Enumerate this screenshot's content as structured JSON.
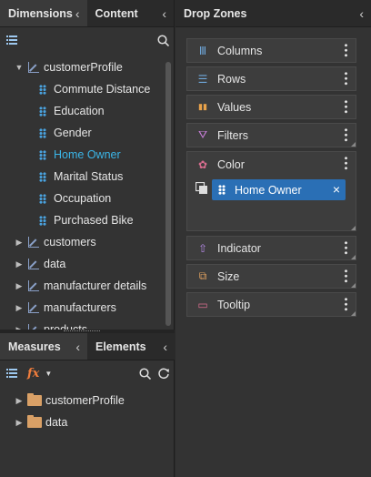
{
  "left_top": {
    "tabs": [
      {
        "label": "Dimensions",
        "chevron": "‹"
      },
      {
        "label": "Content",
        "chevron": "‹"
      }
    ],
    "tree": [
      {
        "label": "customerProfile",
        "expanded": true,
        "children": [
          {
            "label": "Commute Distance"
          },
          {
            "label": "Education"
          },
          {
            "label": "Gender"
          },
          {
            "label": "Home Owner",
            "highlighted": true
          },
          {
            "label": "Marital Status"
          },
          {
            "label": "Occupation"
          },
          {
            "label": "Purchased Bike"
          }
        ]
      },
      {
        "label": "customers"
      },
      {
        "label": "data"
      },
      {
        "label": "manufacturer details"
      },
      {
        "label": "manufacturers"
      },
      {
        "label": "products"
      }
    ]
  },
  "left_bottom": {
    "tabs": [
      {
        "label": "Measures",
        "chevron": "‹"
      },
      {
        "label": "Elements",
        "chevron": "‹"
      }
    ],
    "fx_label": "fx",
    "tree": [
      {
        "label": "customerProfile"
      },
      {
        "label": "data"
      }
    ]
  },
  "drop_zones": {
    "title": "Drop Zones",
    "chevron": "‹",
    "zones": [
      {
        "label": "Columns",
        "icon": "columns-icon",
        "glyph": "Ⅲ",
        "color": "#6fa8dc"
      },
      {
        "label": "Rows",
        "icon": "rows-icon",
        "glyph": "☰",
        "color": "#6fa8dc"
      },
      {
        "label": "Values",
        "icon": "values-icon",
        "glyph": "▮▮",
        "color": "#e8a24a"
      },
      {
        "label": "Filters",
        "icon": "filter-icon",
        "glyph": "⛛",
        "color": "#c77ed8"
      },
      {
        "label": "Color",
        "icon": "color-palette-icon",
        "glyph": "✿",
        "color": "#d86d8f"
      },
      {
        "label": "Indicator",
        "icon": "indicator-icon",
        "glyph": "⇧",
        "color": "#b48ae6"
      },
      {
        "label": "Size",
        "icon": "size-icon",
        "glyph": "⧉",
        "color": "#e0a060"
      },
      {
        "label": "Tooltip",
        "icon": "tooltip-icon",
        "glyph": "▭",
        "color": "#d86d8f"
      }
    ],
    "color_chip": {
      "label": "Home Owner",
      "close": "×"
    }
  },
  "colors": {
    "accent": "#2a6fb5",
    "highlight_text": "#3bb6e8"
  }
}
